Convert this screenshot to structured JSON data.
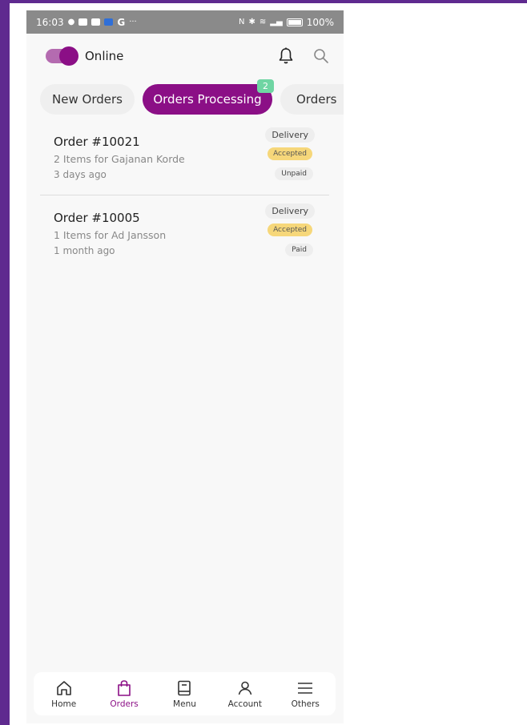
{
  "status_bar": {
    "time": "16:03",
    "battery": "100%",
    "left_icons": [
      "chat-icon",
      "media-icon",
      "media-icon",
      "app-icon",
      "google-icon",
      "more-icon"
    ],
    "right_icons": [
      "nfc-icon",
      "bluetooth-icon",
      "wifi-icon",
      "signal-icon",
      "battery-icon"
    ]
  },
  "header": {
    "online_label": "Online",
    "online_on": true,
    "accent": "#8b0f86"
  },
  "tabs": [
    {
      "label": "New Orders",
      "active": false
    },
    {
      "label": "Orders Processing",
      "active": true,
      "badge": "2"
    },
    {
      "label": "Orders",
      "active": false
    }
  ],
  "orders": [
    {
      "title": "Order #10021",
      "items": "2 Items for Gajanan Korde",
      "time": "3 days ago",
      "type": "Delivery",
      "status": "Accepted",
      "payment": "Unpaid"
    },
    {
      "title": "Order #10005",
      "items": "1 Items for Ad Jansson",
      "time": "1 month ago",
      "type": "Delivery",
      "status": "Accepted",
      "payment": "Paid"
    }
  ],
  "nav": [
    {
      "label": "Home",
      "icon": "home-icon",
      "active": false
    },
    {
      "label": "Orders",
      "icon": "shopping-bag-icon",
      "active": true
    },
    {
      "label": "Menu",
      "icon": "menu-book-icon",
      "active": false
    },
    {
      "label": "Account",
      "icon": "user-icon",
      "active": false
    },
    {
      "label": "Others",
      "icon": "hamburger-icon",
      "active": false
    }
  ]
}
